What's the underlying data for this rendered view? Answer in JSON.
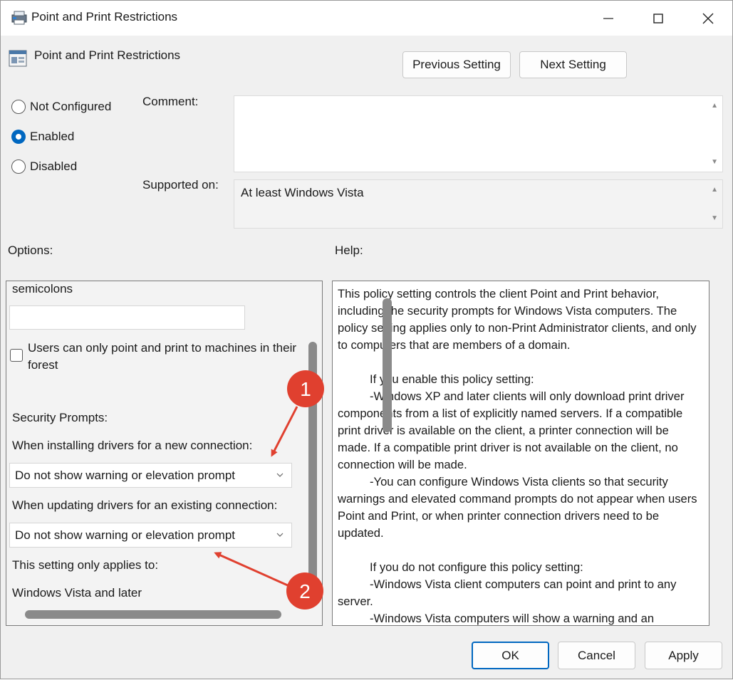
{
  "window": {
    "title": "Point and Print Restrictions"
  },
  "header": {
    "policy_name": "Point and Print Restrictions",
    "previous_label": "Previous Setting",
    "next_label": "Next Setting"
  },
  "state": {
    "options": [
      "Not Configured",
      "Enabled",
      "Disabled"
    ],
    "selected": "Enabled"
  },
  "comment": {
    "label": "Comment:",
    "value": ""
  },
  "supported": {
    "label": "Supported on:",
    "value": "At least Windows Vista"
  },
  "options": {
    "label": "Options:",
    "semicolons_text": "semicolons",
    "servers_value": "",
    "forest_checkbox_label": "Users can only point and print to machines in their forest",
    "forest_checked": false,
    "security_prompts_label": "Security Prompts:",
    "new_connection_label": "When installing drivers for a new connection:",
    "new_connection_value": "Do not show warning or elevation prompt",
    "existing_connection_label": "When updating drivers for an existing connection:",
    "existing_connection_value": "Do not show warning or elevation prompt",
    "applies_label": "This setting only applies to:",
    "applies_value": "Windows Vista and later"
  },
  "help": {
    "label": "Help:",
    "paragraphs": [
      "This policy setting controls the client Point and Print behavior, including the security prompts for Windows Vista computers. The policy setting applies only to non-Print Administrator clients, and only to computers that are members of a domain.",
      "If you enable this policy setting:",
      "-Windows XP and later clients will only download print driver components from a list of explicitly named servers. If a compatible print driver is available on the client, a printer connection will be made. If a compatible print driver is not available on the client, no connection will be made.",
      "-You can configure Windows Vista clients so that security warnings and elevated command prompts do not appear when users Point and Print, or when printer connection drivers need to be updated.",
      "If you do not configure this policy setting:",
      "-Windows Vista client computers can point and print to any server.",
      "-Windows Vista computers will show a warning and an"
    ]
  },
  "footer": {
    "ok_label": "OK",
    "cancel_label": "Cancel",
    "apply_label": "Apply"
  },
  "annotations": {
    "badge_1": "1",
    "badge_2": "2",
    "color": "#e0402f"
  },
  "colors": {
    "accent": "#0067c0"
  }
}
